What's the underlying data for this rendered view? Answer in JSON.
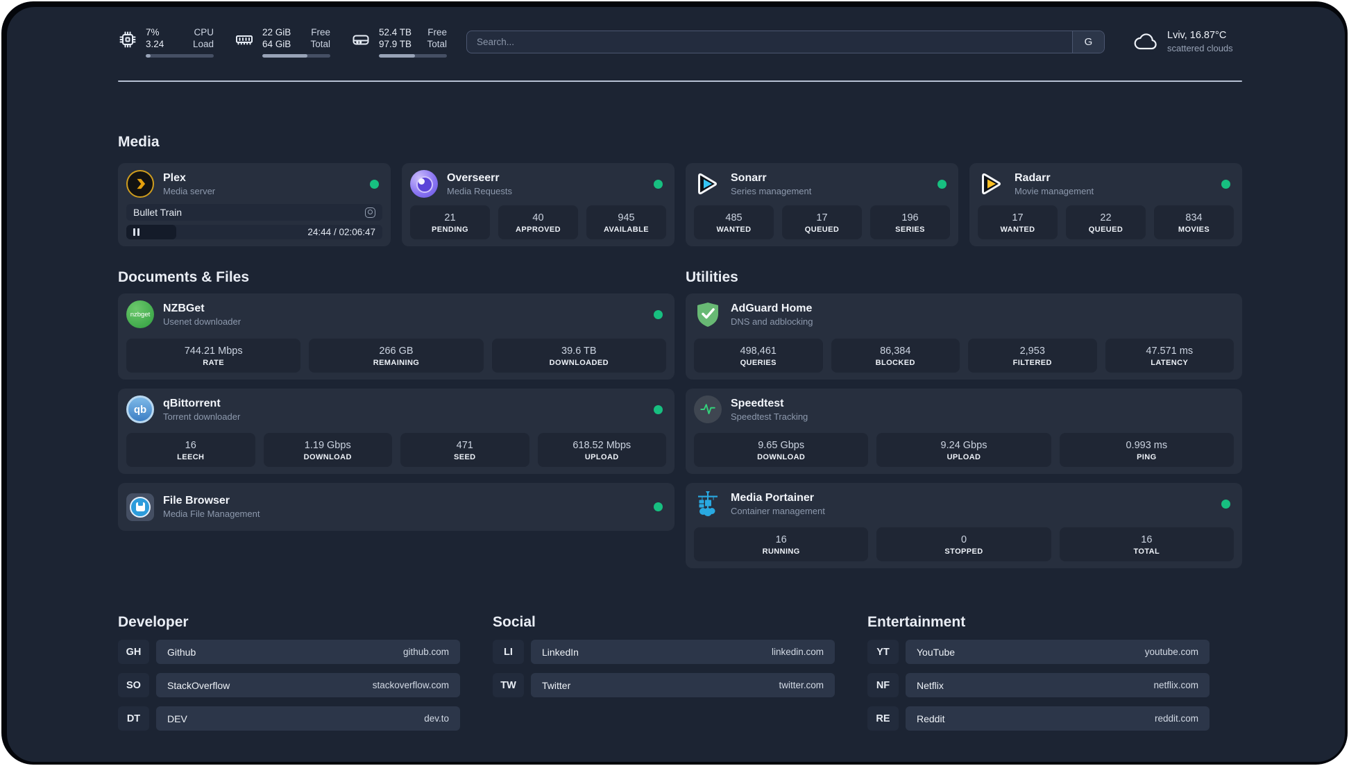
{
  "colors": {
    "page_bg": "#1c2433",
    "card_bg": "#272f3e",
    "stat_box_bg": "#1f2634",
    "status_online": "#17bf80",
    "plex_brand": "#e5a00d",
    "sonarr_brand": "#35c5f4",
    "radarr_brand": "#fbbf24",
    "nzbget_brand": "#3aa64a",
    "qbittorrent_brand": "#4f8fd0",
    "filebrowser_brand": "#2d9cdb",
    "adguard_brand": "#68b974",
    "speedtest_brand": "#34d17b",
    "portainer_brand": "#29a9e1",
    "overseerr_brand": "#8b76f2"
  },
  "header": {
    "stats": [
      {
        "icon": "cpu-icon",
        "row1_value": "7%",
        "row1_label": "CPU",
        "row2_value": "3.24",
        "row2_label": "Load",
        "progress": 7
      },
      {
        "icon": "ram-icon",
        "row1_value": "22 GiB",
        "row1_label": "Free",
        "row2_value": "64 GiB",
        "row2_label": "Total",
        "progress": 66
      },
      {
        "icon": "disk-icon",
        "row1_value": "52.4 TB",
        "row1_label": "Free",
        "row2_value": "97.9 TB",
        "row2_label": "Total",
        "progress": 53
      }
    ],
    "search": {
      "placeholder": "Search...",
      "button_label": "G"
    },
    "weather": {
      "location": "Lviv, 16.87°C",
      "condition": "scattered clouds"
    }
  },
  "sections": {
    "media": {
      "title": "Media",
      "plex": {
        "title": "Plex",
        "subtitle": "Media server",
        "now_playing": "Bullet Train",
        "time": "24:44 / 02:06:47",
        "progress": 19.5
      },
      "overseerr": {
        "title": "Overseerr",
        "subtitle": "Media Requests",
        "stats": [
          {
            "value": "21",
            "label": "PENDING"
          },
          {
            "value": "40",
            "label": "APPROVED"
          },
          {
            "value": "945",
            "label": "AVAILABLE"
          }
        ]
      },
      "sonarr": {
        "title": "Sonarr",
        "subtitle": "Series management",
        "stats": [
          {
            "value": "485",
            "label": "WANTED"
          },
          {
            "value": "17",
            "label": "QUEUED"
          },
          {
            "value": "196",
            "label": "SERIES"
          }
        ]
      },
      "radarr": {
        "title": "Radarr",
        "subtitle": "Movie management",
        "stats": [
          {
            "value": "17",
            "label": "WANTED"
          },
          {
            "value": "22",
            "label": "QUEUED"
          },
          {
            "value": "834",
            "label": "MOVIES"
          }
        ]
      }
    },
    "documents": {
      "title": "Documents & Files",
      "nzbget": {
        "title": "NZBGet",
        "subtitle": "Usenet downloader",
        "icon_text": "nzbget",
        "stats": [
          {
            "value": "744.21 Mbps",
            "label": "RATE"
          },
          {
            "value": "266 GB",
            "label": "REMAINING"
          },
          {
            "value": "39.6 TB",
            "label": "DOWNLOADED"
          }
        ]
      },
      "qbittorrent": {
        "title": "qBittorrent",
        "subtitle": "Torrent downloader",
        "icon_text": "qb",
        "stats": [
          {
            "value": "16",
            "label": "LEECH"
          },
          {
            "value": "1.19 Gbps",
            "label": "DOWNLOAD"
          },
          {
            "value": "471",
            "label": "SEED"
          },
          {
            "value": "618.52 Mbps",
            "label": "UPLOAD"
          }
        ]
      },
      "filebrowser": {
        "title": "File Browser",
        "subtitle": "Media File Management"
      }
    },
    "utilities": {
      "title": "Utilities",
      "adguard": {
        "title": "AdGuard Home",
        "subtitle": "DNS and adblocking",
        "stats": [
          {
            "value": "498,461",
            "label": "QUERIES"
          },
          {
            "value": "86,384",
            "label": "BLOCKED"
          },
          {
            "value": "2,953",
            "label": "FILTERED"
          },
          {
            "value": "47.571 ms",
            "label": "LATENCY"
          }
        ]
      },
      "speedtest": {
        "title": "Speedtest",
        "subtitle": "Speedtest Tracking",
        "stats": [
          {
            "value": "9.65 Gbps",
            "label": "DOWNLOAD"
          },
          {
            "value": "9.24 Gbps",
            "label": "UPLOAD"
          },
          {
            "value": "0.993 ms",
            "label": "PING"
          }
        ]
      },
      "portainer": {
        "title": "Media Portainer",
        "subtitle": "Container management",
        "stats": [
          {
            "value": "16",
            "label": "RUNNING"
          },
          {
            "value": "0",
            "label": "STOPPED"
          },
          {
            "value": "16",
            "label": "TOTAL"
          }
        ]
      }
    },
    "developer": {
      "title": "Developer",
      "links": [
        {
          "abbr": "GH",
          "name": "Github",
          "url": "github.com"
        },
        {
          "abbr": "SO",
          "name": "StackOverflow",
          "url": "stackoverflow.com"
        },
        {
          "abbr": "DT",
          "name": "DEV",
          "url": "dev.to"
        }
      ]
    },
    "social": {
      "title": "Social",
      "links": [
        {
          "abbr": "LI",
          "name": "LinkedIn",
          "url": "linkedin.com"
        },
        {
          "abbr": "TW",
          "name": "Twitter",
          "url": "twitter.com"
        }
      ]
    },
    "entertainment": {
      "title": "Entertainment",
      "links": [
        {
          "abbr": "YT",
          "name": "YouTube",
          "url": "youtube.com"
        },
        {
          "abbr": "NF",
          "name": "Netflix",
          "url": "netflix.com"
        },
        {
          "abbr": "RE",
          "name": "Reddit",
          "url": "reddit.com"
        }
      ]
    }
  }
}
